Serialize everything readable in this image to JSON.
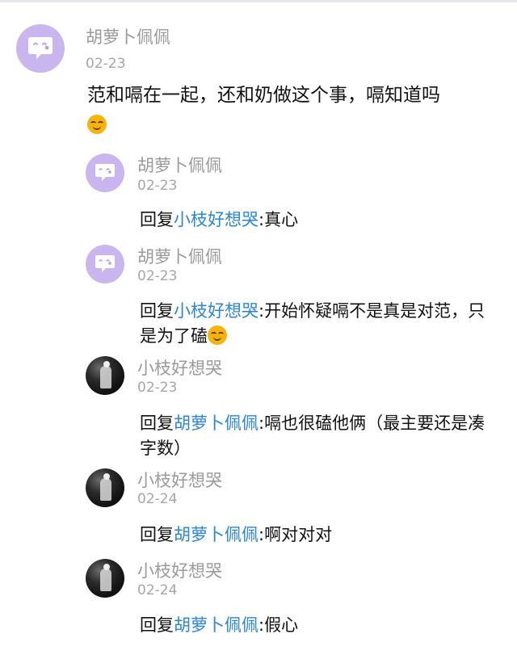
{
  "post": {
    "author": "胡萝卜佩佩",
    "date": "02-23",
    "content": "范和嗝在一起，还和奶做这个事，嗝知道吗",
    "emoji": "smirk-emoji"
  },
  "replies": [
    {
      "author": "胡萝卜佩佩",
      "date": "02-23",
      "prefix": "回复",
      "target": "小枝好想哭",
      "text": ":真心",
      "avatar": "bubble-avatar"
    },
    {
      "author": "胡萝卜佩佩",
      "date": "02-23",
      "prefix": "回复",
      "target": "小枝好想哭",
      "text": ":开始怀疑嗝不是真是对范，只是为了磕",
      "emoji": "smirk-emoji",
      "avatar": "bubble-avatar"
    },
    {
      "author": "小枝好想哭",
      "date": "02-23",
      "prefix": "回复",
      "target": "胡萝卜佩佩",
      "text": ":嗝也很磕他俩（最主要还是凑字数）",
      "avatar": "photo-avatar"
    },
    {
      "author": "小枝好想哭",
      "date": "02-24",
      "prefix": "回复",
      "target": "胡萝卜佩佩",
      "text": ":啊对对对",
      "avatar": "photo-avatar"
    },
    {
      "author": "小枝好想哭",
      "date": "02-24",
      "prefix": "回复",
      "target": "胡萝卜佩佩",
      "text": ":假心",
      "avatar": "photo-avatar"
    }
  ],
  "colors": {
    "link": "#2a86d6",
    "name": "#9a9a9a",
    "avatar_bg": "#c9b6ee"
  }
}
